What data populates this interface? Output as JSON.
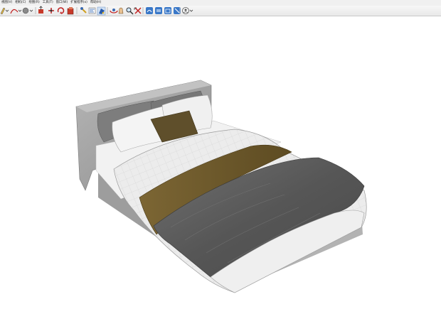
{
  "menu": {
    "items": [
      {
        "label": "视图(V)"
      },
      {
        "label": "相机(C)"
      },
      {
        "label": "绘图(R)"
      },
      {
        "label": "工具(T)"
      },
      {
        "label": "窗口(W)"
      },
      {
        "label": "扩展程序(x)"
      },
      {
        "label": "帮助(H)"
      }
    ]
  },
  "toolbar": {
    "tools": [
      {
        "icon": "pencil-icon"
      },
      {
        "icon": "arc-icon"
      },
      {
        "icon": "sphere-icon"
      },
      {
        "icon": "push-pull-icon"
      },
      {
        "icon": "move-icon"
      },
      {
        "icon": "rotate-icon"
      },
      {
        "icon": "follow-me-icon"
      },
      {
        "icon": "tape-measure-icon"
      },
      {
        "icon": "text-icon"
      },
      {
        "icon": "paint-bucket-icon"
      },
      {
        "icon": "orbit-icon"
      },
      {
        "icon": "pan-icon"
      },
      {
        "icon": "zoom-icon"
      },
      {
        "icon": "zoom-extents-icon"
      },
      {
        "icon": "warehouse-icon"
      },
      {
        "icon": "extension-warehouse-icon"
      },
      {
        "icon": "layout-icon"
      },
      {
        "icon": "style-builder-icon"
      },
      {
        "icon": "account-icon"
      }
    ]
  },
  "scene": {
    "model": "double bed with grey upholstered frame, white duvet, grey and olive throws, pillows"
  },
  "colors": {
    "frame": "#a9a9a9",
    "duvet": "#e9e9e9",
    "throw_grey": "#5e5e5e",
    "throw_olive": "#6e5a2c",
    "cushion": "#5f4f2b"
  }
}
